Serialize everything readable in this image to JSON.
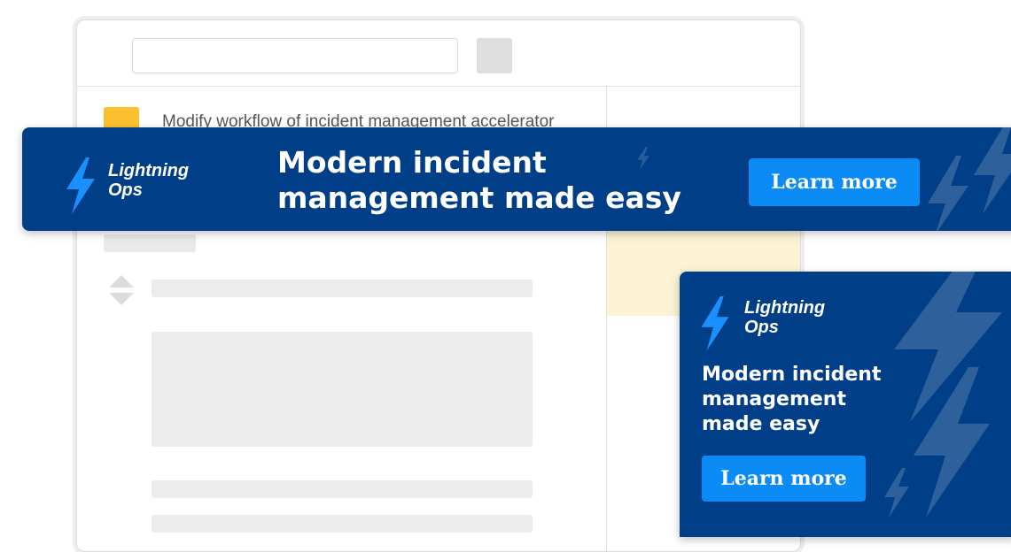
{
  "background_app": {
    "search": {
      "placeholder": ""
    },
    "ticket": {
      "title": "Modify workflow of incident management accelerator"
    }
  },
  "banner_ad": {
    "logo": {
      "line1": "Lightning",
      "line2": "Ops"
    },
    "headline_line1": "Modern incident",
    "headline_line2": "management made easy",
    "cta_label": "Learn more"
  },
  "box_ad": {
    "logo": {
      "line1": "Lightning",
      "line2": "Ops"
    },
    "headline_line1": "Modern incident",
    "headline_line2": "management",
    "headline_line3": "made easy",
    "cta_label": "Learn more"
  },
  "icons": {
    "logo": "lightning-bolt-icon",
    "decoration": "lightning-bolt-icon",
    "ticket": "ticket-type-icon",
    "sort": "sort-icon"
  },
  "colors": {
    "ad_background": "#003f87",
    "cta_background": "#0b8bf5",
    "bolt_blue": "#1a8fff",
    "ticket_icon": "#fbc02d",
    "side_panel": "#fbf3d4"
  }
}
